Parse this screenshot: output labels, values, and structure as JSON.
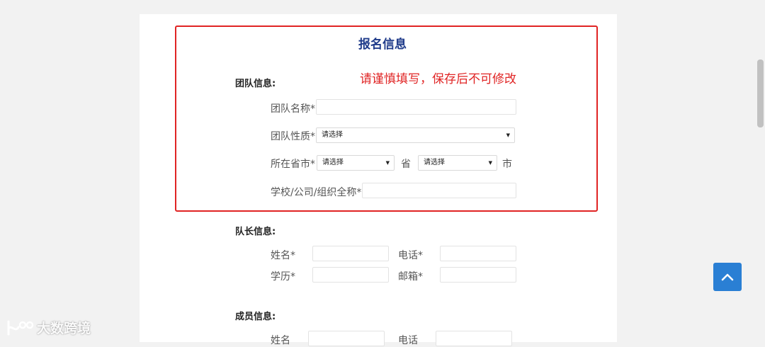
{
  "form": {
    "title": "报名信息",
    "notice": "请谨慎填写，保存后不可修改",
    "team_section": {
      "heading": "团队信息:",
      "team_name_label": "团队名称*",
      "team_type_label": "团队性质*",
      "team_type_value": "请选择",
      "location_label": "所在省市*",
      "province_value": "请选择",
      "province_unit": "省",
      "city_value": "请选择",
      "city_unit": "市",
      "org_label": "学校/公司/组织全称*"
    },
    "leader_section": {
      "heading": "队长信息:",
      "name_label": "姓名*",
      "phone_label": "电话*",
      "education_label": "学历*",
      "email_label": "邮箱*"
    },
    "member_section": {
      "heading": "成员信息:",
      "name_label": "姓名",
      "phone_label": "电话"
    }
  },
  "watermark": {
    "text": "大数跨境"
  },
  "icons": {
    "back_to_top": "chevron-up-icon",
    "dropdown": "caret-down-icon",
    "watermark_logo": "logo-icon"
  },
  "colors": {
    "accent_blue": "#2a7fd4",
    "title_blue": "#1f3b8a",
    "warning_red": "#e02424"
  }
}
